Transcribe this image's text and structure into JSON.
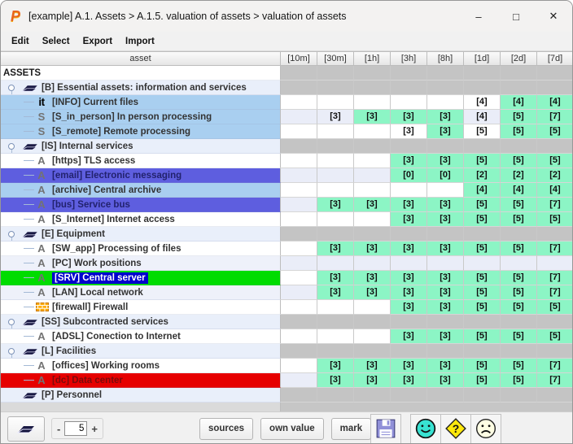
{
  "window": {
    "logo_letter": "P",
    "title": "[example] A.1. Assets > A.1.5. valuation of assets > valuation of assets",
    "controls": {
      "minimize": "–",
      "maximize": "□",
      "close": "✕"
    }
  },
  "menu": {
    "items": [
      "Edit",
      "Select",
      "Export",
      "Import"
    ]
  },
  "table": {
    "asset_header": "asset",
    "time_columns": [
      "[10m]",
      "[30m]",
      "[1h]",
      "[3h]",
      "[8h]",
      "[1d]",
      "[2d]",
      "[7d]"
    ],
    "rows": [
      {
        "label": "ASSETS",
        "kind": "root",
        "icon": null,
        "highlight": "none",
        "cells": [
          null,
          null,
          null,
          null,
          null,
          null,
          null,
          null
        ]
      },
      {
        "label": "[B] Essential assets: information and services",
        "kind": "group",
        "icon": "folder",
        "expander": true,
        "highlight": "none",
        "cells": [
          null,
          null,
          null,
          null,
          null,
          null,
          null,
          null
        ]
      },
      {
        "label": "[INFO] Current files",
        "kind": "leaf",
        "icon": "it",
        "highlight": "lightblue",
        "cells": [
          null,
          null,
          null,
          null,
          null,
          {
            "v": "[4]",
            "o": true
          },
          {
            "v": "[4]"
          },
          {
            "v": "[4]"
          }
        ]
      },
      {
        "label": "[S_in_person] In person processing",
        "kind": "leaf",
        "icon": "S",
        "highlight": "lightblue",
        "cells": [
          null,
          {
            "v": "[3]",
            "o": true
          },
          {
            "v": "[3]"
          },
          {
            "v": "[3]"
          },
          {
            "v": "[3]"
          },
          {
            "v": "[4]",
            "o": true
          },
          {
            "v": "[5]"
          },
          {
            "v": "[7]"
          }
        ]
      },
      {
        "label": "[S_remote] Remote processing",
        "kind": "leaf",
        "icon": "S",
        "highlight": "lightblue",
        "cells": [
          null,
          null,
          null,
          {
            "v": "[3]",
            "o": true
          },
          {
            "v": "[3]"
          },
          {
            "v": "[5]",
            "o": true
          },
          {
            "v": "[5]"
          },
          {
            "v": "[5]"
          }
        ]
      },
      {
        "label": "[IS] Internal services",
        "kind": "group",
        "icon": "folder",
        "expander": true,
        "highlight": "none",
        "cells": [
          null,
          null,
          null,
          null,
          null,
          null,
          null,
          null
        ]
      },
      {
        "label": "[https] TLS access",
        "kind": "leaf",
        "icon": "A",
        "highlight": "none",
        "cells": [
          null,
          null,
          null,
          {
            "v": "[3]"
          },
          {
            "v": "[3]"
          },
          {
            "v": "[5]"
          },
          {
            "v": "[5]"
          },
          {
            "v": "[5]"
          }
        ]
      },
      {
        "label": "[email] Electronic messaging",
        "kind": "leaf",
        "icon": "A",
        "highlight": "blue",
        "cells": [
          null,
          null,
          null,
          {
            "v": "[0]"
          },
          {
            "v": "[0]"
          },
          {
            "v": "[2]"
          },
          {
            "v": "[2]"
          },
          {
            "v": "[2]"
          }
        ]
      },
      {
        "label": "[archive] Central archive",
        "kind": "leaf",
        "icon": "A",
        "highlight": "lightblue",
        "cells": [
          null,
          null,
          null,
          null,
          null,
          {
            "v": "[4]"
          },
          {
            "v": "[4]"
          },
          {
            "v": "[4]"
          }
        ]
      },
      {
        "label": "[bus] Service bus",
        "kind": "leaf",
        "icon": "A",
        "highlight": "blue",
        "cells": [
          null,
          {
            "v": "[3]"
          },
          {
            "v": "[3]"
          },
          {
            "v": "[3]"
          },
          {
            "v": "[3]"
          },
          {
            "v": "[5]"
          },
          {
            "v": "[5]"
          },
          {
            "v": "[7]"
          }
        ]
      },
      {
        "label": "[S_Internet] Internet access",
        "kind": "leaf",
        "icon": "A",
        "highlight": "none",
        "cells": [
          null,
          null,
          null,
          {
            "v": "[3]"
          },
          {
            "v": "[3]"
          },
          {
            "v": "[5]"
          },
          {
            "v": "[5]"
          },
          {
            "v": "[5]"
          }
        ]
      },
      {
        "label": "[E] Equipment",
        "kind": "group",
        "icon": "folder",
        "expander": true,
        "highlight": "none",
        "cells": [
          null,
          null,
          null,
          null,
          null,
          null,
          null,
          null
        ]
      },
      {
        "label": "[SW_app] Processing of files",
        "kind": "leaf",
        "icon": "A",
        "highlight": "none",
        "cells": [
          null,
          {
            "v": "[3]"
          },
          {
            "v": "[3]"
          },
          {
            "v": "[3]"
          },
          {
            "v": "[3]"
          },
          {
            "v": "[5]"
          },
          {
            "v": "[5]"
          },
          {
            "v": "[7]"
          }
        ]
      },
      {
        "label": "[PC] Work positions",
        "kind": "leaf",
        "icon": "A",
        "highlight": "none",
        "cells": [
          null,
          null,
          null,
          null,
          null,
          null,
          null,
          null
        ]
      },
      {
        "label": "[SRV] Central server",
        "kind": "leaf",
        "icon": "A",
        "highlight": "green",
        "selected": true,
        "cells": [
          null,
          {
            "v": "[3]"
          },
          {
            "v": "[3]"
          },
          {
            "v": "[3]"
          },
          {
            "v": "[3]"
          },
          {
            "v": "[5]"
          },
          {
            "v": "[5]"
          },
          {
            "v": "[7]"
          }
        ]
      },
      {
        "label": "[LAN] Local network",
        "kind": "leaf",
        "icon": "A",
        "highlight": "none",
        "cells": [
          null,
          {
            "v": "[3]"
          },
          {
            "v": "[3]"
          },
          {
            "v": "[3]"
          },
          {
            "v": "[3]"
          },
          {
            "v": "[5]"
          },
          {
            "v": "[5]"
          },
          {
            "v": "[7]"
          }
        ]
      },
      {
        "label": "[firewall] Firewall",
        "kind": "leaf",
        "icon": "firewall",
        "highlight": "none",
        "cells": [
          null,
          null,
          null,
          {
            "v": "[3]"
          },
          {
            "v": "[3]"
          },
          {
            "v": "[5]"
          },
          {
            "v": "[5]"
          },
          {
            "v": "[5]"
          }
        ]
      },
      {
        "label": "[SS] Subcontracted services",
        "kind": "group",
        "icon": "folder",
        "expander": true,
        "highlight": "none",
        "cells": [
          null,
          null,
          null,
          null,
          null,
          null,
          null,
          null
        ]
      },
      {
        "label": "[ADSL] Conection to Internet",
        "kind": "leaf",
        "icon": "A",
        "highlight": "none",
        "cells": [
          null,
          null,
          null,
          {
            "v": "[3]"
          },
          {
            "v": "[3]"
          },
          {
            "v": "[5]"
          },
          {
            "v": "[5]"
          },
          {
            "v": "[5]"
          }
        ]
      },
      {
        "label": "[L] Facilities",
        "kind": "group",
        "icon": "folder",
        "expander": true,
        "highlight": "none",
        "cells": [
          null,
          null,
          null,
          null,
          null,
          null,
          null,
          null
        ]
      },
      {
        "label": "[offices] Working rooms",
        "kind": "leaf",
        "icon": "A",
        "highlight": "none",
        "cells": [
          null,
          {
            "v": "[3]"
          },
          {
            "v": "[3]"
          },
          {
            "v": "[3]"
          },
          {
            "v": "[3]"
          },
          {
            "v": "[5]"
          },
          {
            "v": "[5]"
          },
          {
            "v": "[7]"
          }
        ]
      },
      {
        "label": "[dc] Data center",
        "kind": "leaf",
        "icon": "A",
        "highlight": "red",
        "cells": [
          null,
          {
            "v": "[3]"
          },
          {
            "v": "[3]"
          },
          {
            "v": "[3]"
          },
          {
            "v": "[3]"
          },
          {
            "v": "[5]"
          },
          {
            "v": "[5]"
          },
          {
            "v": "[7]"
          }
        ]
      },
      {
        "label": "[P] Personnel",
        "kind": "group",
        "icon": "folder",
        "expander": false,
        "highlight": "none",
        "cells": [
          null,
          null,
          null,
          null,
          null,
          null,
          null,
          null
        ]
      }
    ]
  },
  "toolbar": {
    "spinner": {
      "minus": "-",
      "value": "5",
      "plus": "+"
    },
    "buttons": [
      "sources",
      "own value",
      "mark"
    ],
    "icon_names": [
      "folder-icon",
      "floppy-save-icon",
      "happy-face-icon",
      "question-help-icon",
      "sad-face-icon"
    ]
  },
  "colors": {
    "value_green": "#8CF5C5",
    "stripe_alt": "#EAEDF8",
    "group_cell_gray": "#C4C4C4",
    "row_lightblue": "#A9CFF0",
    "row_blue": "#5E5EDF",
    "row_green": "#00DC00",
    "row_red": "#E60000",
    "selection_blue": "#0000CC",
    "text_on_blue_row": "#22226E",
    "text_on_red_row": "#7A0C0C",
    "logo_orange": "#E8641C"
  }
}
